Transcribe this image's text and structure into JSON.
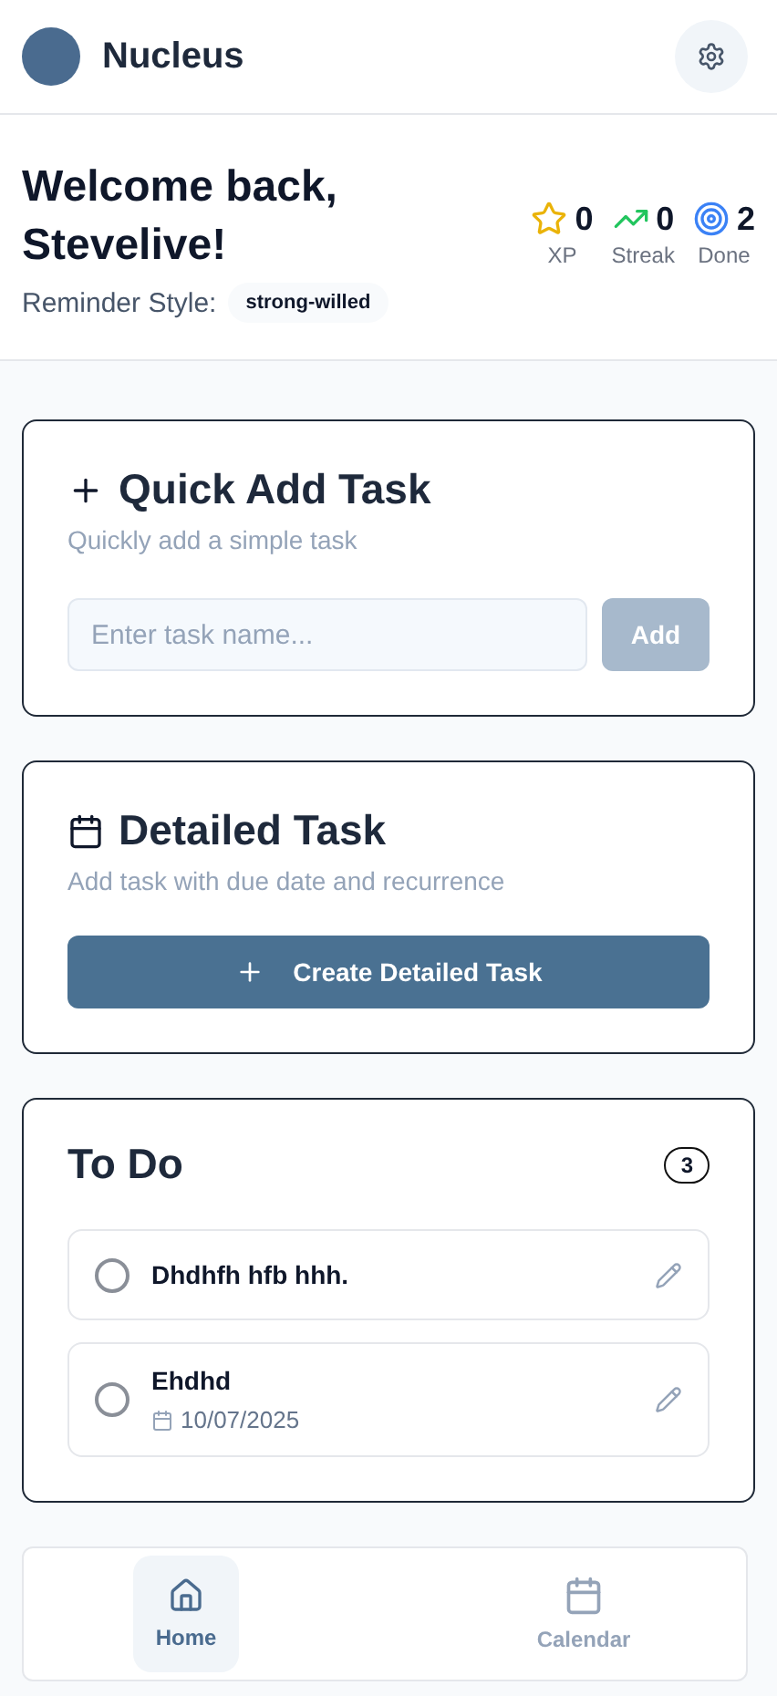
{
  "header": {
    "app_name": "Nucleus"
  },
  "welcome": {
    "title": "Welcome back, Stevelive!",
    "reminder_label": "Reminder Style:",
    "reminder_value": "strong-willed"
  },
  "stats": [
    {
      "kind": "xp",
      "value": "0",
      "label": "XP"
    },
    {
      "kind": "streak",
      "value": "0",
      "label": "Streak"
    },
    {
      "kind": "done",
      "value": "2",
      "label": "Done"
    }
  ],
  "quick_add": {
    "title": "Quick Add Task",
    "subtitle": "Quickly add a simple task",
    "placeholder": "Enter task name...",
    "button": "Add",
    "button_disabled": true
  },
  "detailed": {
    "title": "Detailed Task",
    "subtitle": "Add task with due date and recurrence",
    "button": "Create Detailed Task"
  },
  "todo": {
    "title": "To Do",
    "count": "3",
    "tasks": [
      {
        "name": "Dhdhfh hfb hhh.",
        "checked": false
      },
      {
        "name": "Ehdhd",
        "date": "10/07/2025",
        "checked": false
      }
    ]
  },
  "nav": [
    {
      "label": "Home",
      "kind": "home",
      "selected": true
    },
    {
      "label": "Calendar",
      "kind": "calendar",
      "selected": false
    }
  ]
}
